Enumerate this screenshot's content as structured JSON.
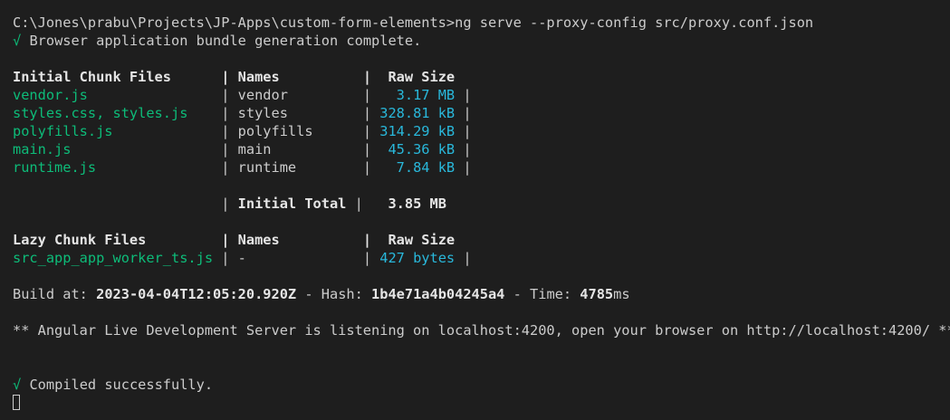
{
  "prompt": {
    "path": "C:\\Jones\\prabu\\Projects\\JP-Apps\\custom-form-elements>",
    "command": "ng serve --proxy-config src/proxy.conf.json"
  },
  "bundle_status": {
    "check": "√",
    "text": "Browser application bundle generation complete."
  },
  "initial_table": {
    "headers": [
      "Initial Chunk Files",
      "Names",
      "Raw Size"
    ],
    "rows": [
      {
        "file": "vendor.js",
        "name": "vendor",
        "size": "3.17 MB"
      },
      {
        "file": "styles.css, styles.js",
        "name": "styles",
        "size": "328.81 kB"
      },
      {
        "file": "polyfills.js",
        "name": "polyfills",
        "size": "314.29 kB"
      },
      {
        "file": "main.js",
        "name": "main",
        "size": "45.36 kB"
      },
      {
        "file": "runtime.js",
        "name": "runtime",
        "size": "7.84 kB"
      }
    ],
    "total_label": "Initial Total",
    "total_value": "3.85 MB"
  },
  "lazy_table": {
    "headers": [
      "Lazy Chunk Files",
      "Names",
      "Raw Size"
    ],
    "rows": [
      {
        "file": "src_app_app_worker_ts.js",
        "name": "-",
        "size": "427 bytes"
      }
    ]
  },
  "build_info": {
    "build_at_label": "Build at: ",
    "build_at_value": "2023-04-04T12:05:20.920Z",
    "hash_label": " - Hash: ",
    "hash_value": "1b4e71a4b04245a4",
    "time_label": " - Time: ",
    "time_value": "4785",
    "time_unit": "ms"
  },
  "server_message": "** Angular Live Development Server is listening on localhost:4200, open your browser on http://localhost:4200/ **",
  "compiled_status": {
    "check": "√",
    "text": "Compiled successfully."
  },
  "colors": {
    "background": "#1e1e1e",
    "text": "#cccccc",
    "green": "#0dbc79",
    "blue": "#29b8db"
  }
}
